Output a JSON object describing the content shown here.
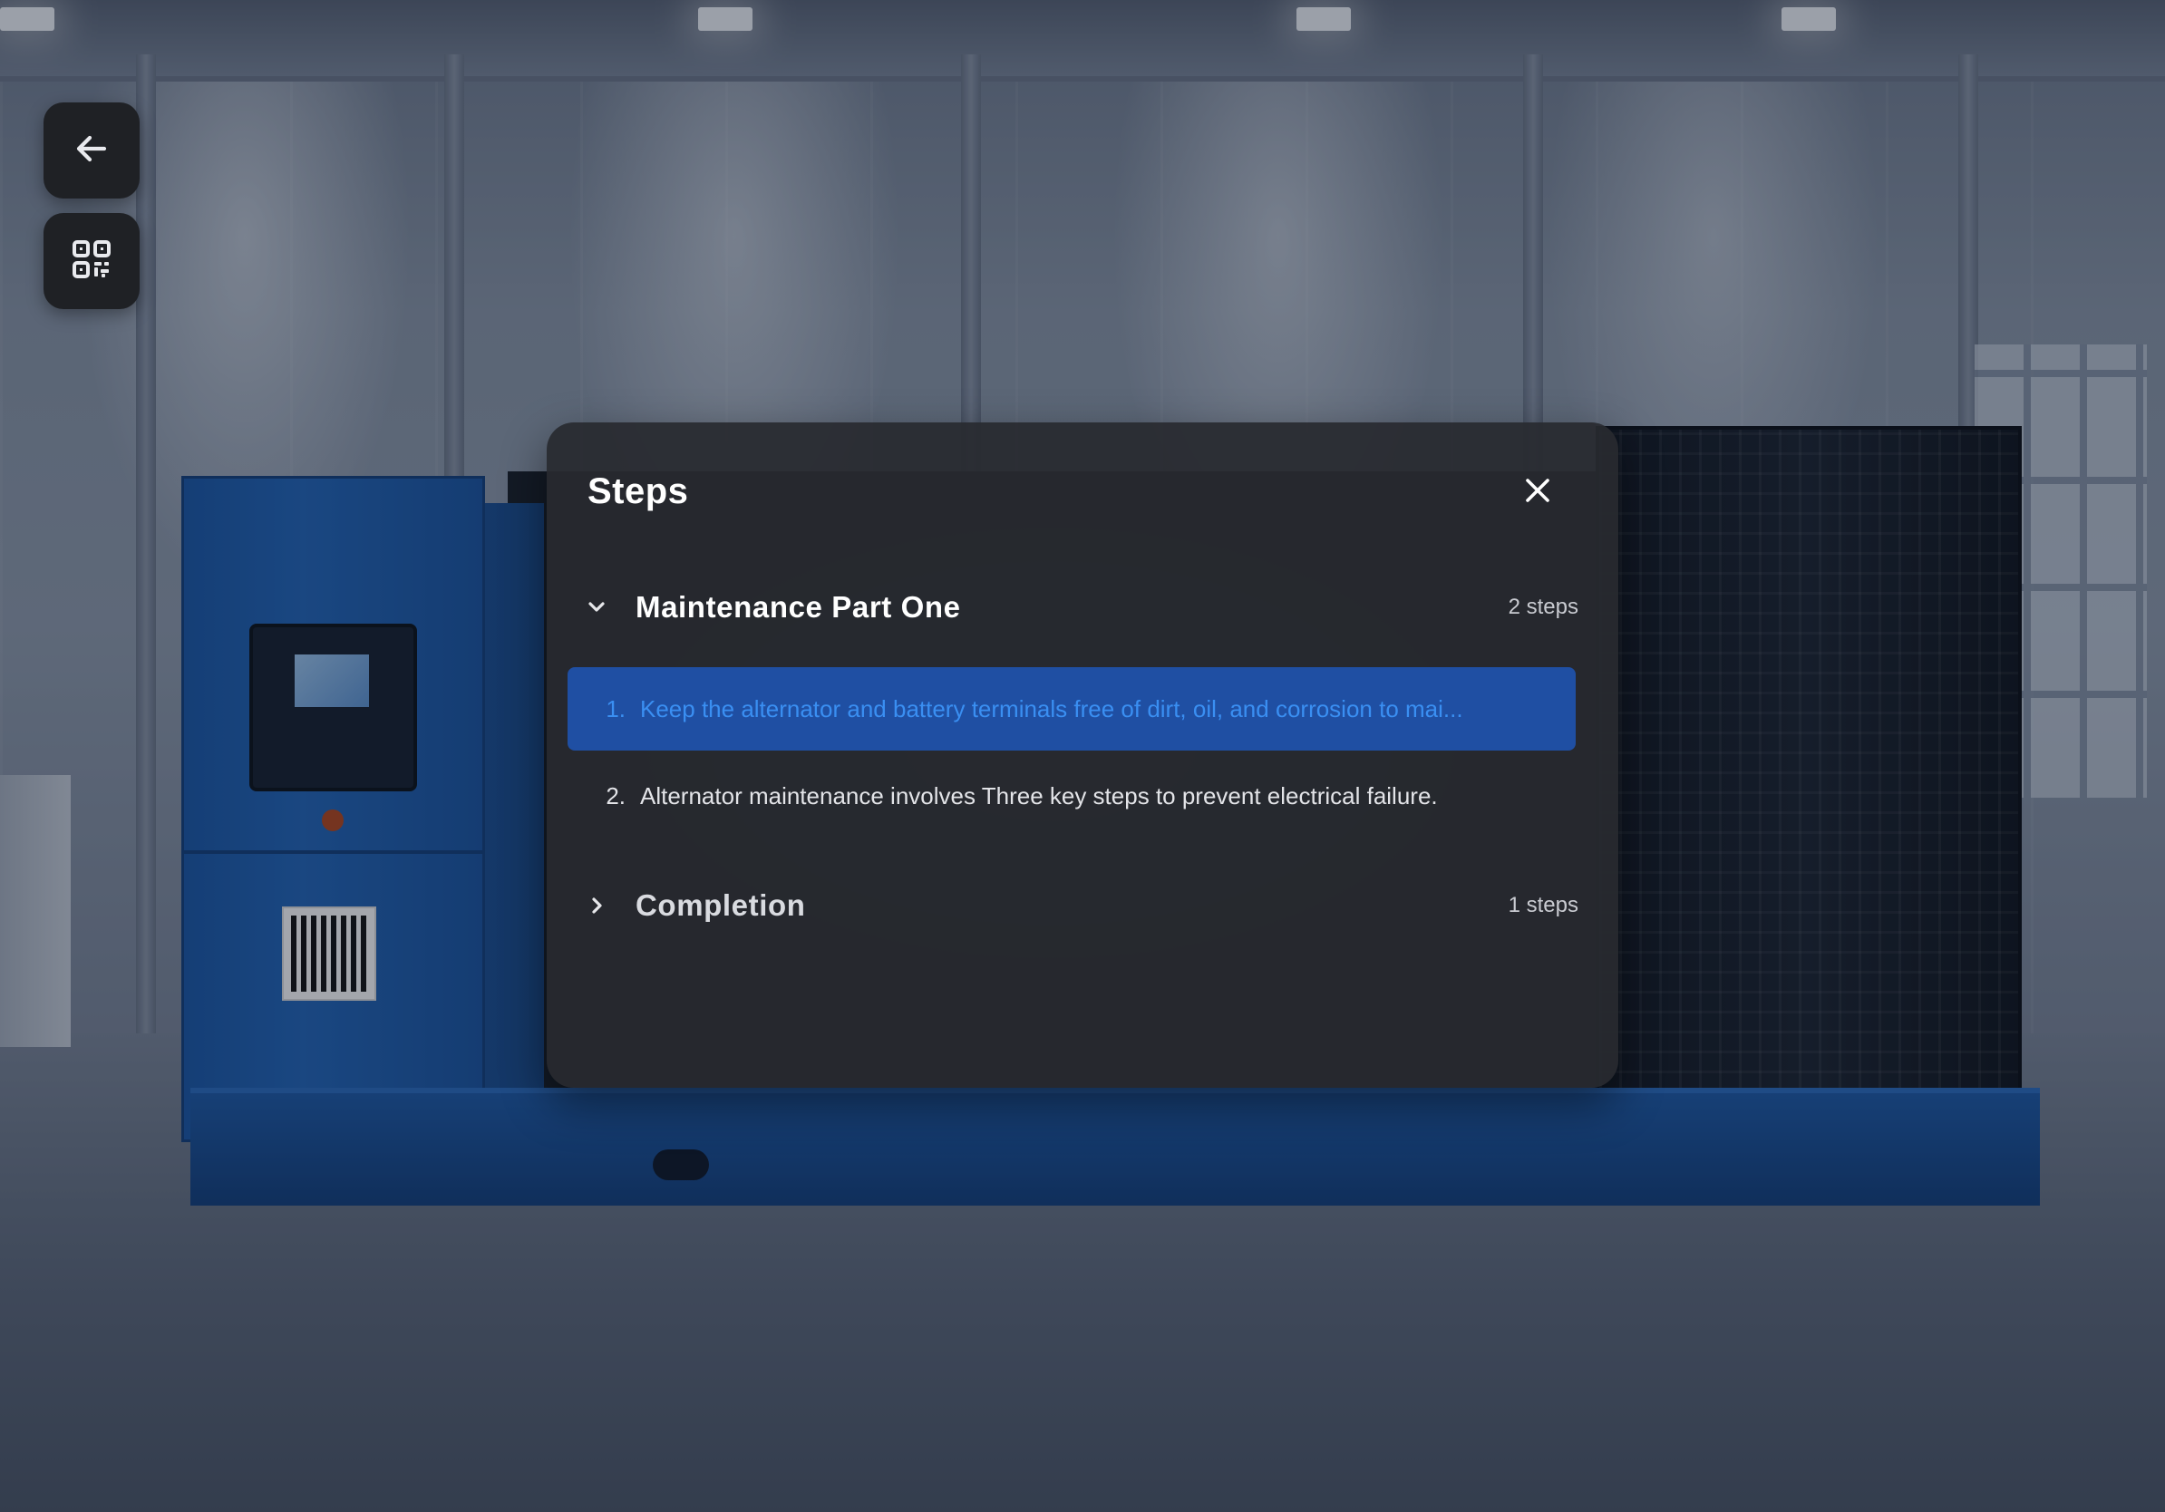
{
  "modal": {
    "title": "Steps",
    "close_icon": "close-icon"
  },
  "sections": [
    {
      "title": "Maintenance Part One",
      "count": "2 steps",
      "expanded": true,
      "steps": [
        {
          "number": "1.",
          "text": "Keep the alternator and battery terminals free of dirt, oil, and corrosion to mai...",
          "selected": true
        },
        {
          "number": "2.",
          "text": "Alternator maintenance involves Three key steps to prevent electrical failure.",
          "selected": false
        }
      ]
    },
    {
      "title": "Completion",
      "count": "1 steps",
      "expanded": false
    }
  ],
  "side_buttons": {
    "back_icon": "arrow-left-icon",
    "qr_icon": "qr-code-icon"
  },
  "colors": {
    "selected_row_bg": "#1f4fa3",
    "selected_row_text": "#3a8ff2",
    "modal_bg": "#28292f",
    "button_bg": "#1f2125"
  }
}
